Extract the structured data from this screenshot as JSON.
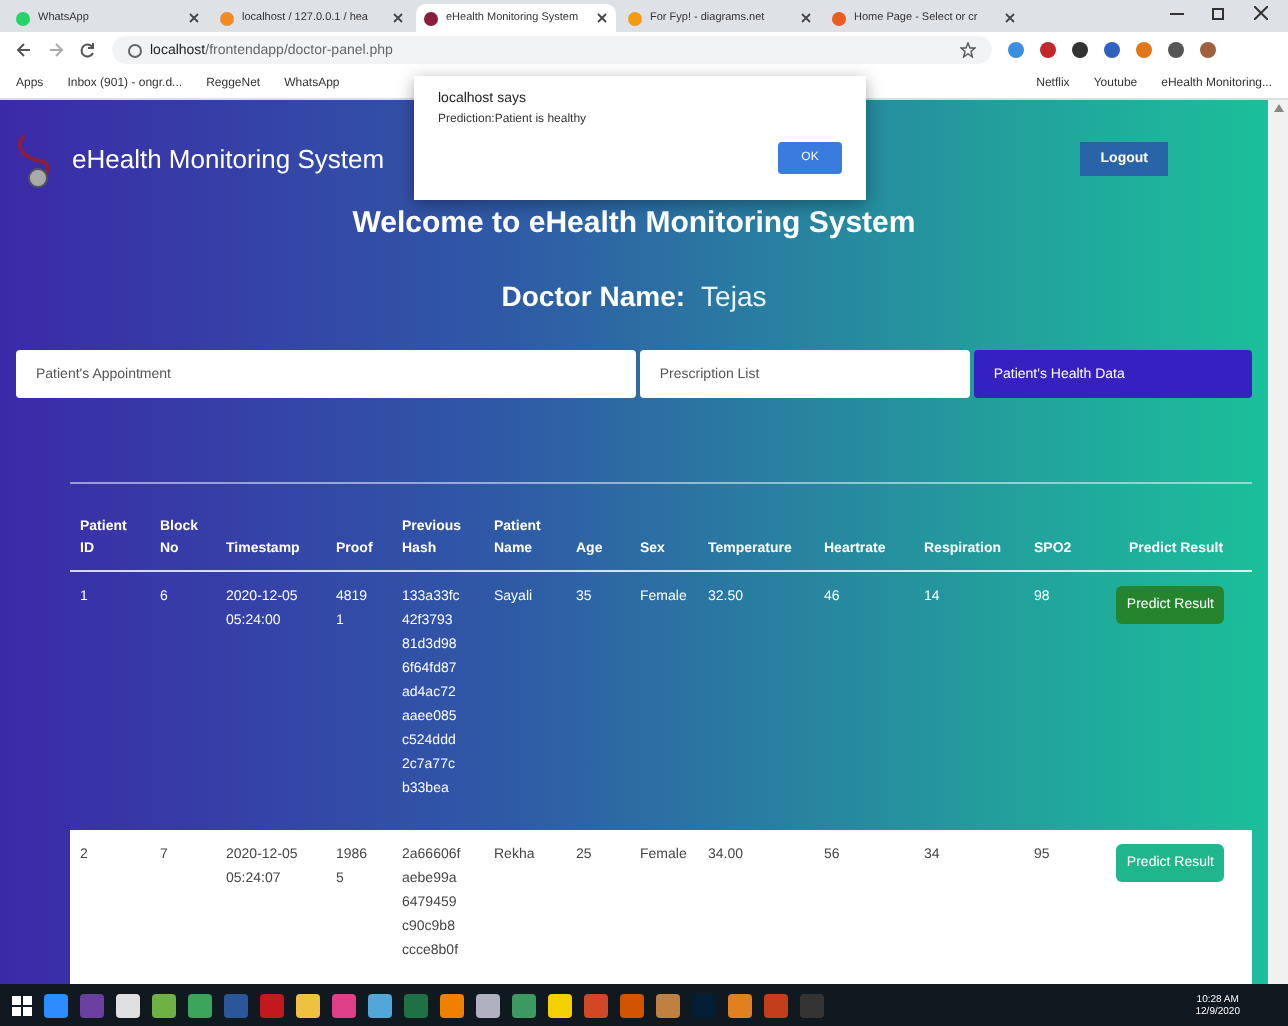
{
  "browser": {
    "tabs": [
      {
        "title": "WhatsApp",
        "selected": false
      },
      {
        "title": "localhost / 127.0.0.1 / hea",
        "selected": false
      },
      {
        "title": "eHealth Monitoring System",
        "selected": true
      },
      {
        "title": "For Fyp! - diagrams.net",
        "selected": false
      },
      {
        "title": "Home Page - Select or cr",
        "selected": false
      }
    ],
    "address": {
      "host": "localhost",
      "path": "/frontendapp/doctor-panel.php"
    },
    "bookmarks": [
      "Apps",
      "Inbox (901) - ongr.d...",
      "ReggeNet",
      "WhatsApp",
      "Netflix",
      "Youtube",
      "eHealth Monitoring..."
    ]
  },
  "page": {
    "brand": "eHealth Monitoring System",
    "logout": "Logout",
    "welcome": "Welcome to eHealth Monitoring System",
    "doctor_label": "Doctor Name:",
    "doctor_name": "Tejas",
    "nav": [
      {
        "label": "Patient's Appointment",
        "selected": false
      },
      {
        "label": "Prescription List",
        "selected": false
      },
      {
        "label": "Patient's Health Data",
        "selected": true
      }
    ],
    "table": {
      "columns": [
        [
          "Patient",
          "ID"
        ],
        [
          "Block",
          "No"
        ],
        [
          "Timestamp"
        ],
        [
          "Proof"
        ],
        [
          "Previous",
          "Hash"
        ],
        [
          "Patient",
          "Name"
        ],
        [
          "Age"
        ],
        [
          "Sex"
        ],
        [
          "Temperature"
        ],
        [
          "Heartrate"
        ],
        [
          "Respiration"
        ],
        [
          "SPO2"
        ],
        [
          "Predict Result"
        ]
      ],
      "rows": [
        {
          "hovered": false,
          "id": "1",
          "block": "6",
          "timestamp": [
            "2020-12-05",
            "05:24:00"
          ],
          "proof": [
            "4819",
            "1"
          ],
          "hash": [
            "133a33fc",
            "42f3793",
            "81d3d98",
            "6f64fd87",
            "ad4ac72",
            "aaee085",
            "c524ddd",
            "2c7a77c",
            "b33bea"
          ],
          "name": "Sayali",
          "age": "35",
          "sex": "Female",
          "temperature": "32.50",
          "heartrate": "46",
          "respiration": "14",
          "spo2": "98",
          "action": "Predict Result"
        },
        {
          "hovered": true,
          "id": "2",
          "block": "7",
          "timestamp": [
            "2020-12-05",
            "05:24:07"
          ],
          "proof": [
            "1986",
            "5"
          ],
          "hash": [
            "2a66606f",
            "aebe99a",
            "6479459",
            "c90c9b8",
            "ccce8b0f"
          ],
          "name": "Rekha",
          "age": "25",
          "sex": "Female",
          "temperature": "34.00",
          "heartrate": "56",
          "respiration": "34",
          "spo2": "95",
          "action": "Predict Result"
        }
      ]
    }
  },
  "dialog": {
    "title": "localhost says",
    "message": "Prediction:Patient is healthy",
    "button": "OK"
  },
  "taskbar": {
    "time": "10:28 AM",
    "date": "12/9/2020"
  }
}
